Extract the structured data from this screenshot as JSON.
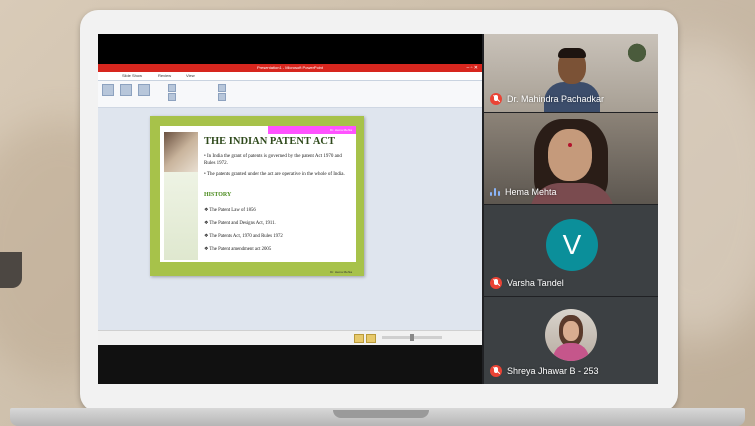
{
  "presentation": {
    "window_title": "Presentation1 - Microsoft PowerPoint",
    "ribbon_tabs": [
      "Slide Show",
      "Review",
      "View"
    ],
    "slide": {
      "badge": "Dr. Hema Mehta",
      "heading": "THE INDIAN PATENT ACT",
      "bullets": [
        "In India the grant of patents is governed by the patent Act 1970 and Rules 1972.",
        "The patents granted under the act are operative in the whole of India."
      ],
      "history_heading": "HISTORY",
      "history_items": [
        "The Patent Law of 1856",
        "The Patent and Designs Act, 1911.",
        "The Patents Act, 1970 and Rules 1972",
        "The Patent amendment act 2005"
      ],
      "footer": "Dr. Hema Mehta"
    }
  },
  "participants": [
    {
      "name": "Dr. Mahindra Pachadkar",
      "muted": true
    },
    {
      "name": "Hema Mehta",
      "muted": false,
      "speaking": true
    },
    {
      "name": "Varsha Tandel",
      "muted": true,
      "avatar_letter": "V"
    },
    {
      "name": "Shreya Jhawar B - 253",
      "muted": true
    }
  ]
}
